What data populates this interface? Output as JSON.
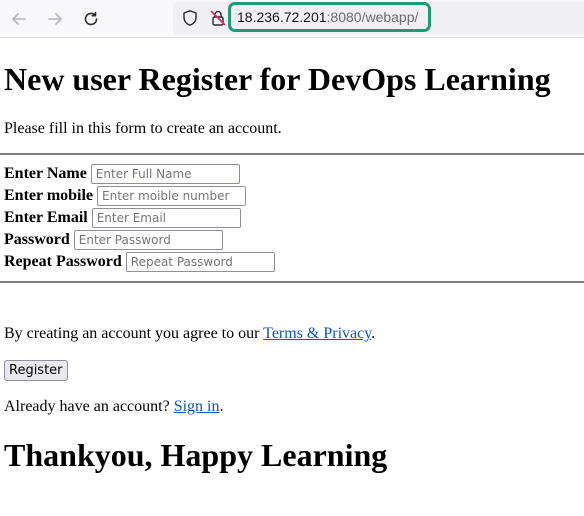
{
  "browser": {
    "url_host": "18.236.72.201",
    "url_rest": ":8080/webapp/"
  },
  "page": {
    "heading": "New user Register for DevOps Learning",
    "intro": "Please fill in this form to create an account.",
    "fields": [
      {
        "label": "Enter Name",
        "placeholder": "Enter Full Name",
        "value": ""
      },
      {
        "label": "Enter mobile",
        "placeholder": "Enter moible number",
        "value": ""
      },
      {
        "label": "Enter Email",
        "placeholder": "Enter Email",
        "value": ""
      },
      {
        "label": "Password",
        "placeholder": "Enter Password",
        "value": ""
      },
      {
        "label": "Repeat Password",
        "placeholder": "Repeat Password",
        "value": ""
      }
    ],
    "agree_prefix": "By creating an account you agree to our ",
    "terms_link": "Terms & Privacy",
    "agree_suffix": ".",
    "register_label": "Register",
    "signin_prefix": "Already have an account? ",
    "signin_link": "Sign in",
    "signin_suffix": ".",
    "thanks": "Thankyou, Happy Learning"
  }
}
